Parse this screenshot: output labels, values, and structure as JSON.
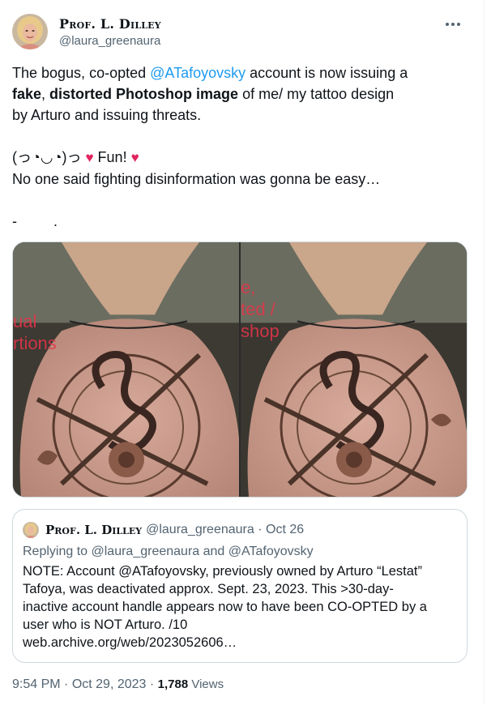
{
  "author": {
    "display_name": "Prof. L. Dilley",
    "handle": "@laura_greenaura"
  },
  "more_icon": "more-horizontal-icon",
  "tweet": {
    "line1_a": "The bogus, co-opted ",
    "line1_mention": "@ATafoyovsky",
    "line1_b": " account is now issuing a",
    "line2_bold1": "fake",
    "line2_comma": ", ",
    "line2_bold2": "distorted Photoshop image",
    "line2_rest": " of me/ my tattoo design",
    "line3": "by Arturo and issuing threats.",
    "line5_kaomoji": "(っ◔◡◔)っ ",
    "heart": "♥",
    "line5_fun": " Fun! ",
    "line6": "No one said fighting disinformation was gonna be easy…",
    "line8": "-         ."
  },
  "media": {
    "left_overlay": "ual\nrtions",
    "right_overlay": "e,\nted /\nshop"
  },
  "quote": {
    "display_name": "Prof. L. Dilley",
    "handle": "@laura_greenaura",
    "separator": " · ",
    "date": "Oct 26",
    "reply_prefix": "Replying to ",
    "reply_to1": "@laura_greenaura",
    "reply_and": " and ",
    "reply_to2": "@ATafoyovsky",
    "body_lines": [
      "NOTE: Account @ATafoyovsky, previously owned by Arturo “Lestat”",
      "Tafoya, was deactivated approx. Sept. 23, 2023. This >30-day-",
      "inactive account handle appears now to have been CO-OPTED by a",
      "user who is NOT Arturo. /10",
      "web.archive.org/web/2023052606…"
    ]
  },
  "footer": {
    "time": "9:54 PM",
    "date": "Oct 29, 2023",
    "separator": " · ",
    "views_count": "1,788",
    "views_label": " Views"
  },
  "colors": {
    "link": "#1d9bf0",
    "secondary_text": "#536471",
    "primary_text": "#0f1419",
    "heart": "#e0245e",
    "border": "#cfd9de"
  }
}
